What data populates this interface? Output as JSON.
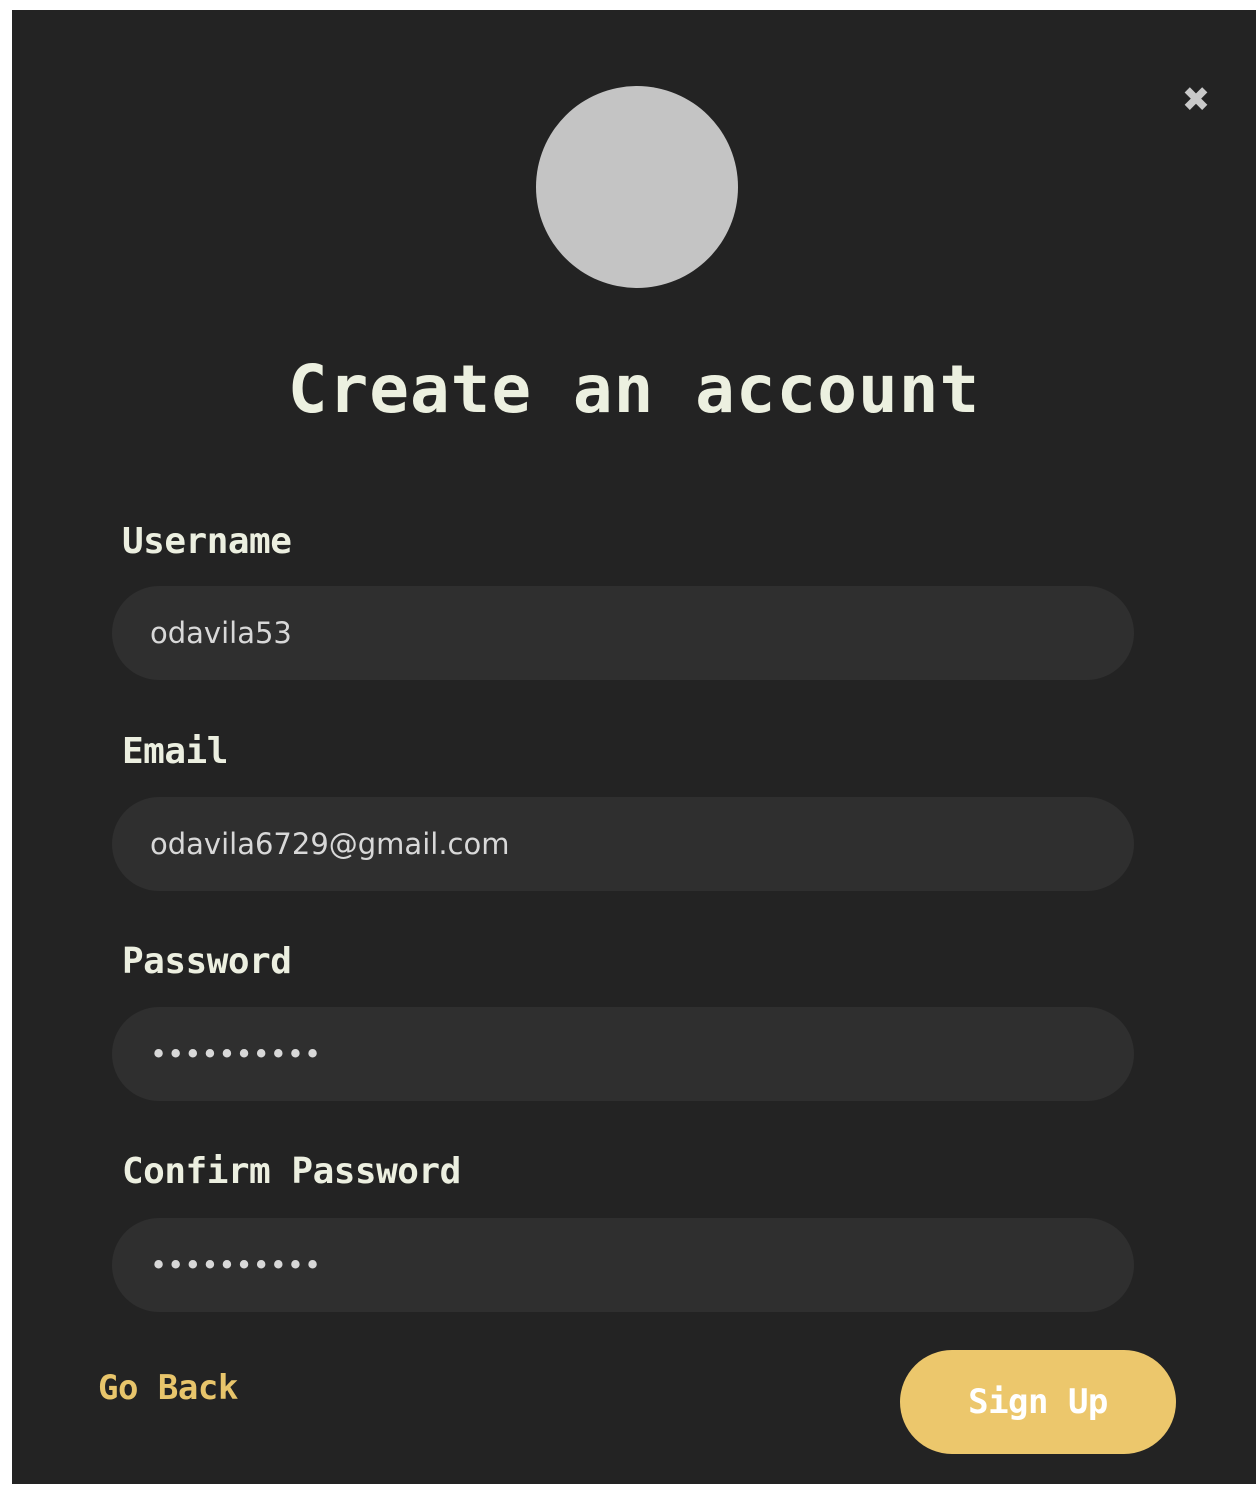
{
  "modal": {
    "close_glyph": "✖",
    "title": "Create an account"
  },
  "form": {
    "username": {
      "label": "Username",
      "value": "odavila53"
    },
    "email": {
      "label": "Email",
      "value": "odavila6729@gmail.com"
    },
    "password": {
      "label": "Password",
      "value": "••••••••••"
    },
    "confirm_password": {
      "label": "Confirm Password",
      "value": "••••••••••"
    }
  },
  "actions": {
    "go_back_label": "Go Back",
    "signup_label": "Sign Up"
  },
  "colors": {
    "background": "#232323",
    "input_background": "#2f2f2f",
    "accent": "#ecc76c",
    "avatar": "#c4c4c4",
    "text": "#ecf0e0"
  }
}
